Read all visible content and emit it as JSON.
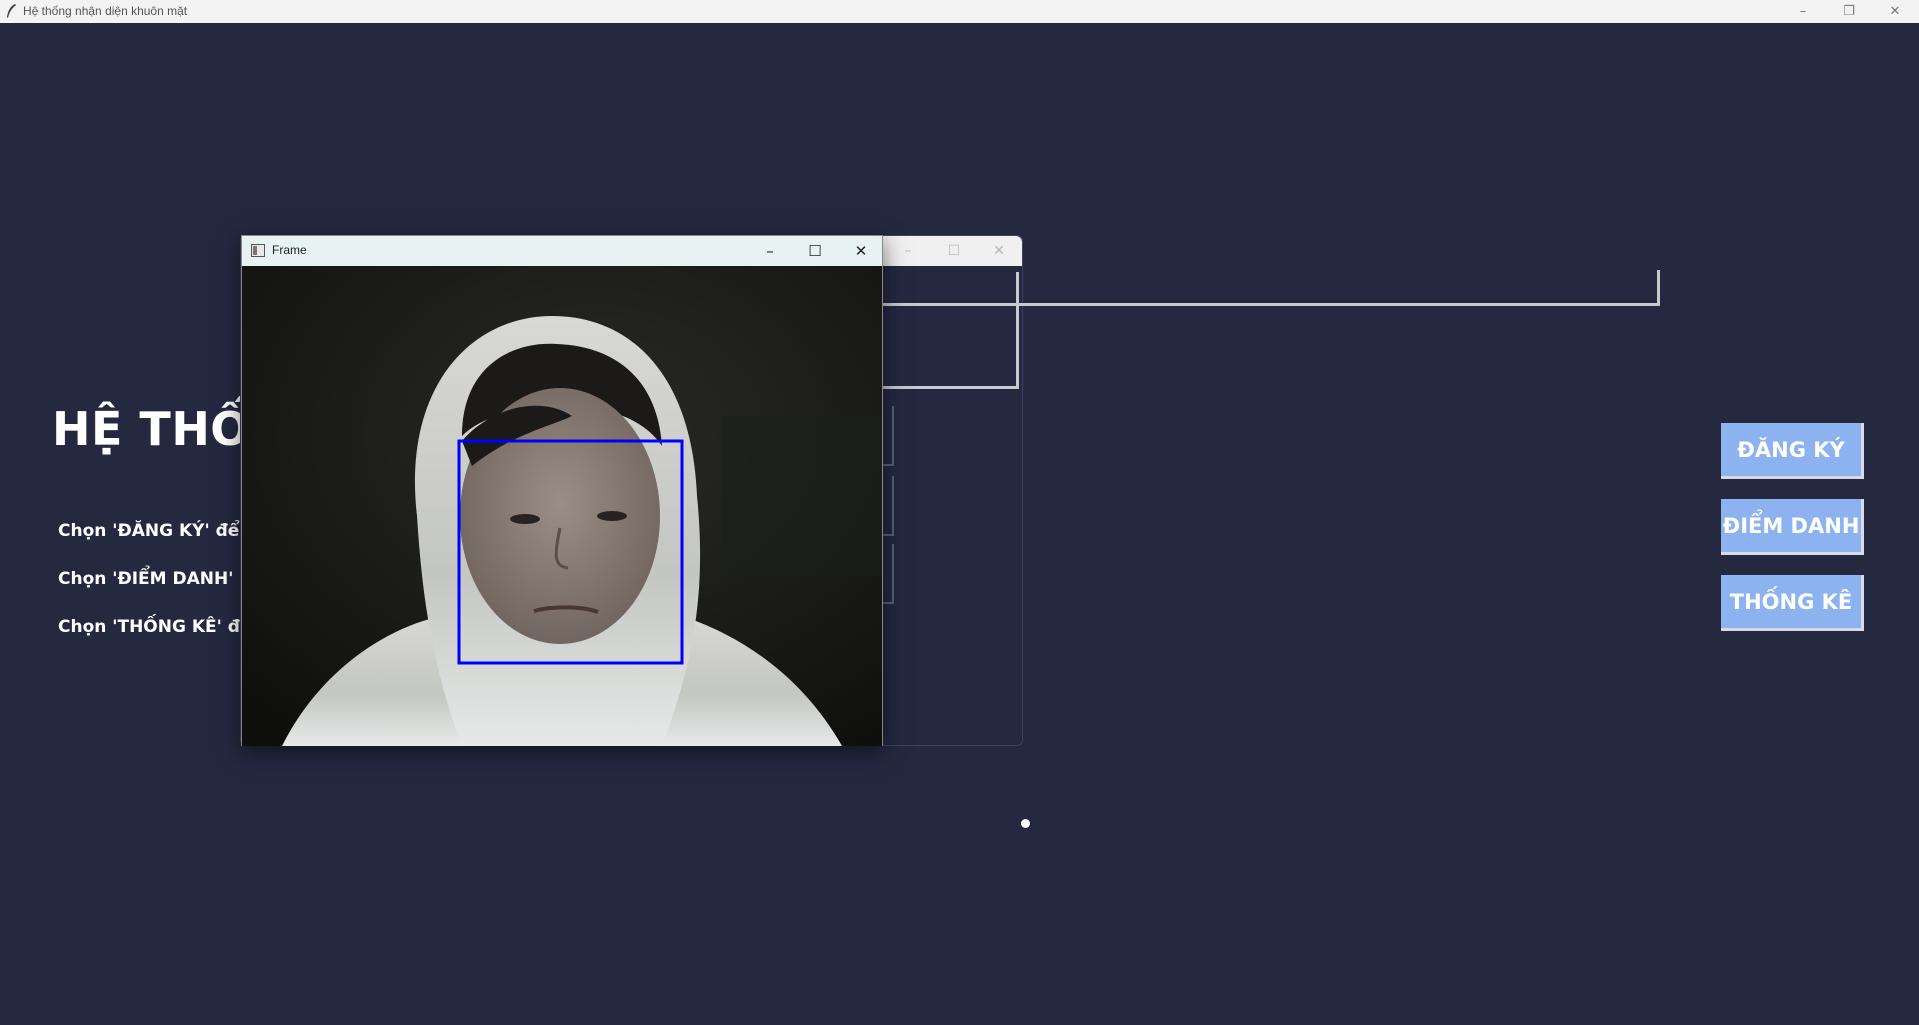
{
  "window": {
    "title": "Hệ thống nhận diện khuôn mặt",
    "controls": {
      "minimize": "–",
      "restore": "❐",
      "close": "✕"
    }
  },
  "main": {
    "heading": "HỆ THỐNG NHẬN DIỆN KHUÔN MẶT",
    "instructions": [
      "Chọn 'ĐĂNG KÝ' để đăng ký khuôn mặt",
      "Chọn 'ĐIỂM DANH' để điểm danh",
      "Chọn 'THỐNG KÊ' để thống kê"
    ],
    "buttons": {
      "register": "ĐĂNG KÝ",
      "attendance": "ĐIỂM DANH",
      "statistics": "THỐNG KÊ"
    },
    "button_color": "#8cb2f0",
    "background_color": "#242940"
  },
  "frame_window": {
    "title": "Frame",
    "controls": {
      "minimize": "–",
      "maximize": "☐",
      "close": "✕"
    },
    "icon": "window-icon",
    "face_box_color": "#0000ff"
  },
  "background_dialog": {
    "controls": {
      "minimize": "–",
      "maximize": "☐",
      "close": "✕"
    }
  }
}
